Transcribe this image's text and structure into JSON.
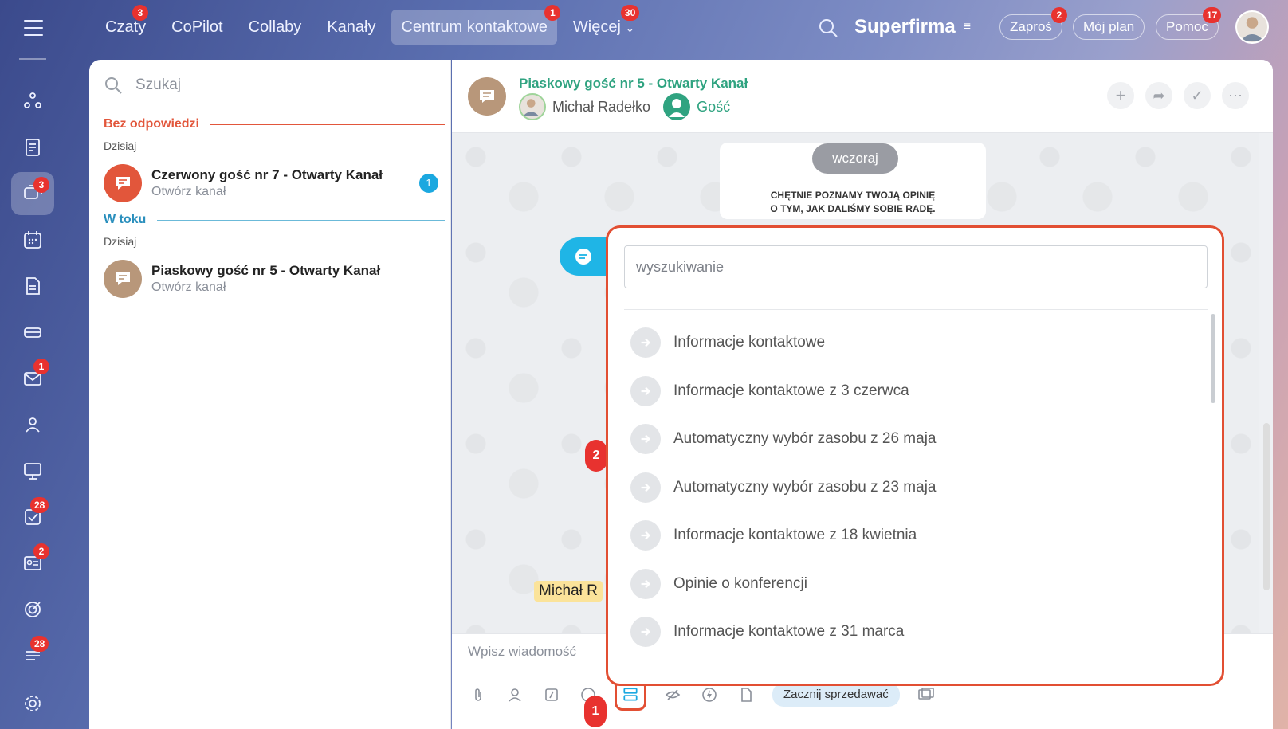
{
  "topnav": {
    "items": [
      {
        "label": "Czaty",
        "badge": "3"
      },
      {
        "label": "CoPilot",
        "badge": ""
      },
      {
        "label": "Collaby",
        "badge": ""
      },
      {
        "label": "Kanały",
        "badge": ""
      },
      {
        "label": "Centrum kontaktowe",
        "badge": "1"
      },
      {
        "label": "Więcej",
        "badge": "30"
      }
    ],
    "brand": "Superfirma",
    "invite": {
      "label": "Zaproś",
      "badge": "2"
    },
    "plan": "Mój plan",
    "help": {
      "label": "Pomoc",
      "badge": "17"
    }
  },
  "sidebar": {
    "badges": {
      "chat": "3",
      "mail": "1",
      "tasks": "28",
      "crm": "2",
      "feed": "28"
    }
  },
  "chatlist": {
    "search_placeholder": "Szukaj",
    "sections": [
      {
        "title": "Bez odpowiedzi",
        "day": "Dzisiaj",
        "color": "#e2563b",
        "conv": {
          "title": "Czerwony gość nr 7 - Otwarty Kanał",
          "subtitle": "Otwórz kanał",
          "count": "1"
        }
      },
      {
        "title": "W toku",
        "day": "Dzisiaj",
        "color": "#2a8fbd",
        "conv": {
          "title": "Piaskowy gość nr 5 - Otwarty Kanał",
          "subtitle": "Otwórz kanał"
        }
      }
    ]
  },
  "chat": {
    "title": "Piaskowy gość nr 5 - Otwarty Kanał",
    "member1": "Michał Radełko",
    "member2": "Gość",
    "date_pill": "wczoraj",
    "system_line1": "CHĘTNIE POZNAMY TWOJĄ OPINIĘ",
    "system_line2": "O TYM, JAK DALIŚMY SOBIE RADĘ.",
    "name_tag": "Michał R",
    "composer_placeholder": "Wpisz wiadomość",
    "sell_button": "Zacznij sprzedawać"
  },
  "popup": {
    "search_placeholder": "wyszukiwanie",
    "items": [
      "Informacje kontaktowe",
      "Informacje kontaktowe z 3 czerwca",
      "Automatyczny wybór zasobu z 26 maja",
      "Automatyczny wybór zasobu z 23 maja",
      "Informacje kontaktowe z 18 kwietnia",
      "Opinie o konferencji",
      "Informacje kontaktowe z 31 marca"
    ]
  },
  "markers": {
    "m1": "1",
    "m2": "2"
  }
}
